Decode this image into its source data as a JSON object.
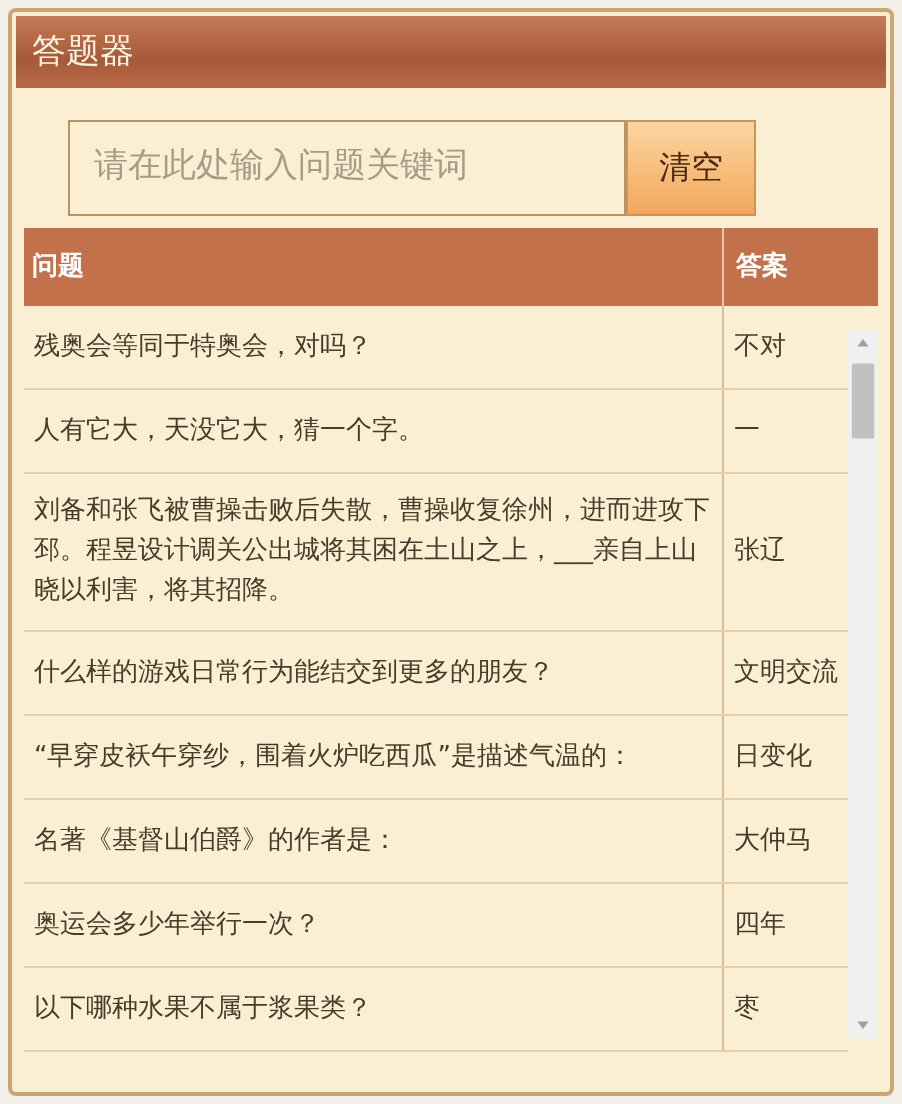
{
  "window": {
    "title": "答题器"
  },
  "search": {
    "placeholder": "请在此处输入问题关键词",
    "button": "清空"
  },
  "table": {
    "columns": [
      "问题",
      "答案"
    ],
    "rows": [
      {
        "question": "残奥会等同于特奥会，对吗？",
        "answer": "不对"
      },
      {
        "question": "人有它大，天没它大，猜一个字。",
        "answer": "一"
      },
      {
        "question": "刘备和张飞被曹操击败后失散，曹操收复徐州，进而进攻下邳。程昱设计调关公出城将其困在土山之上，___亲自上山晓以利害，将其招降。",
        "answer": "张辽"
      },
      {
        "question": "什么样的游戏日常行为能结交到更多的朋友？",
        "answer": "文明交流"
      },
      {
        "question": "“早穿皮袄午穿纱，围着火炉吃西瓜”是描述气温的：",
        "answer": "日变化"
      },
      {
        "question": "名著《基督山伯爵》的作者是：",
        "answer": "大仲马"
      },
      {
        "question": "奥运会多少年举行一次？",
        "answer": "四年"
      },
      {
        "question": "以下哪种水果不属于浆果类？",
        "answer": "枣"
      }
    ]
  }
}
